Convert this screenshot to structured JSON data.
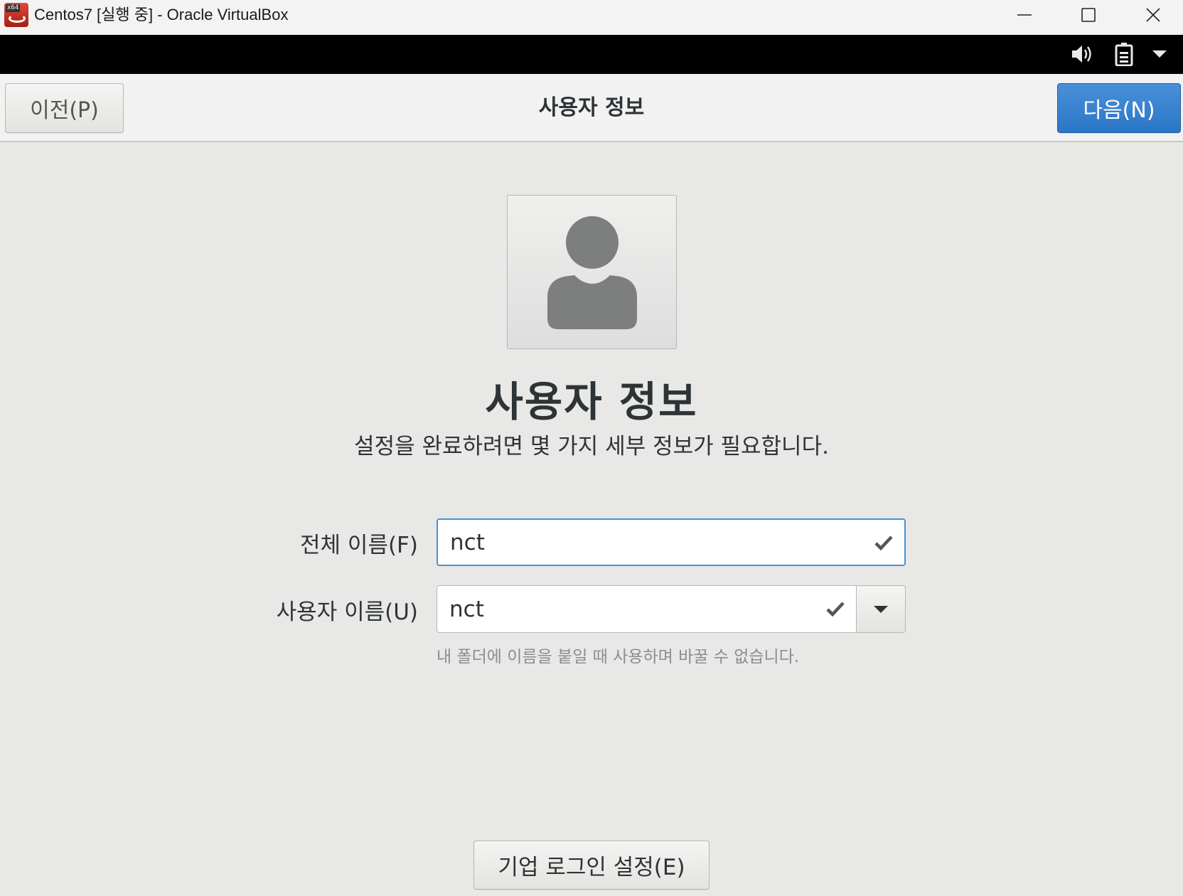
{
  "window": {
    "title": "Centos7 [실행 중] - Oracle VirtualBox",
    "icon_badge": "x64",
    "icons": [
      "minimize-icon",
      "maximize-icon",
      "close-icon"
    ]
  },
  "vm_topbar": {
    "icons": [
      "volume-icon",
      "battery-icon",
      "dropdown-arrow-icon"
    ]
  },
  "header": {
    "back_label": "이전(P)",
    "title": "사용자 정보",
    "next_label": "다음(N)",
    "next_color": "#2a76c6"
  },
  "main": {
    "heading": "사용자 정보",
    "subtitle": "설정을 완료하려면 몇 가지 세부 정보가 필요합니다.",
    "fullname_label": "전체 이름(F)",
    "fullname_value": "nct",
    "username_label": "사용자 이름(U)",
    "username_value": "nct",
    "username_hint": "내 폴더에 이름을 붙일 때 사용하며 바꿀 수 없습니다.",
    "enterprise_button": "기업 로그인 설정(E)"
  }
}
